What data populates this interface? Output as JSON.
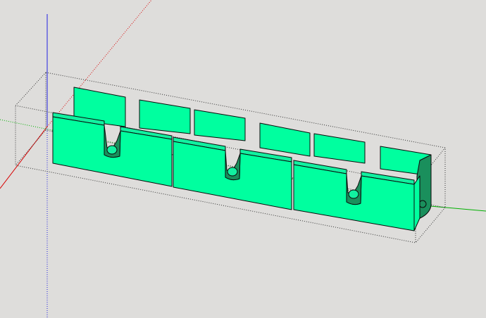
{
  "viewport": {
    "background_color": "#dedddb",
    "model_color": "#00ff9f",
    "model_shadow_color": "#1a8f5c",
    "edge_color": "#0a0a0a",
    "axis_colors": {
      "red": "#d80000",
      "green": "#00b000",
      "blue": "#2020e0"
    },
    "bounding_box_style": "dotted",
    "model": {
      "name_icon": "cable-holder-model-icon",
      "sections": 3
    }
  }
}
